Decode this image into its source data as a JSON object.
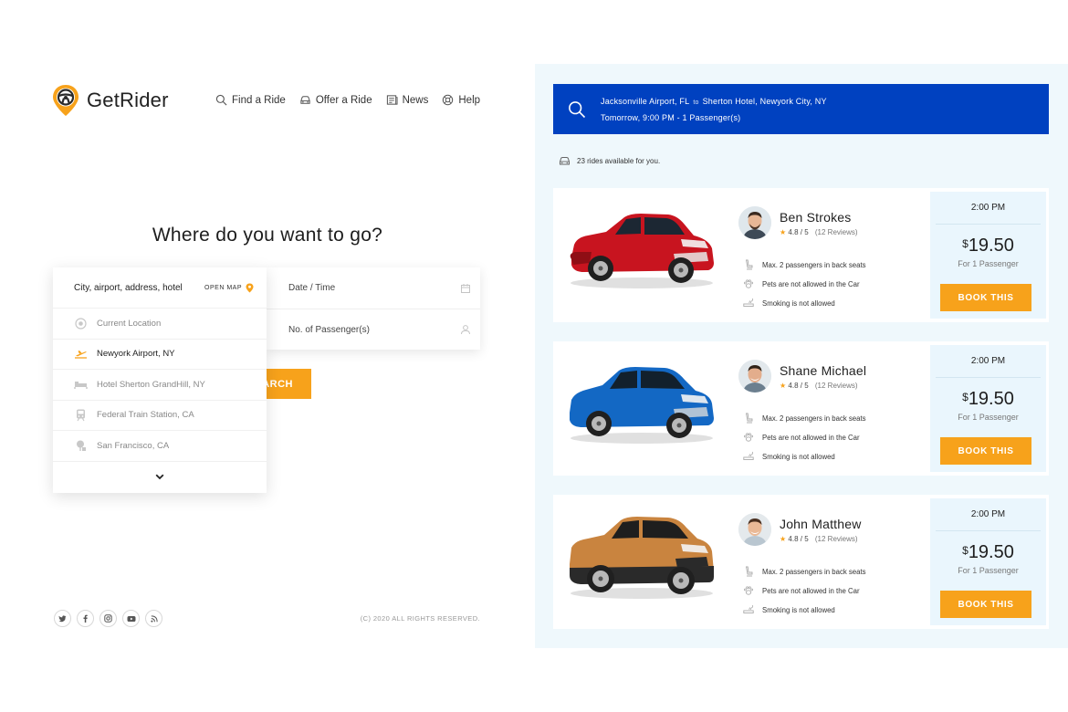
{
  "brand": {
    "name": "GetRider",
    "accent": "#f7a21b",
    "primary": "#0041c0"
  },
  "nav": [
    {
      "label": "Find a Ride",
      "icon": "search-icon"
    },
    {
      "label": "Offer a Ride",
      "icon": "car-icon"
    },
    {
      "label": "News",
      "icon": "news-icon"
    },
    {
      "label": "Help",
      "icon": "help-icon"
    }
  ],
  "hero": {
    "title": "Where do you want to go?"
  },
  "form": {
    "destination_label": "City, airport, address, hotel",
    "open_map_label": "OPEN MAP",
    "date_label": "Date / Time",
    "passengers_label": "No. of Passenger(s)",
    "search_label": "ARCH"
  },
  "dropdown": {
    "items": [
      {
        "label": "Current Location",
        "icon": "location-target-icon",
        "active": false
      },
      {
        "label": "Newyork Airport, NY",
        "icon": "plane-icon",
        "active": true
      },
      {
        "label": "Hotel Sherton GrandHill, NY",
        "icon": "bed-icon",
        "active": false
      },
      {
        "label": "Federal Train Station, CA",
        "icon": "train-icon",
        "active": false
      },
      {
        "label": "San Francisco, CA",
        "icon": "tree-icon",
        "active": false
      }
    ]
  },
  "social": [
    "twitter-icon",
    "facebook-icon",
    "instagram-icon",
    "youtube-icon",
    "rss-icon"
  ],
  "footer": {
    "copyright": "(C) 2020 ALL RIGHTS RESERVED."
  },
  "trip": {
    "from": "Jacksonville  Airport, FL",
    "to_word": "to",
    "to": "Sherton Hotel, Newyork City, NY",
    "when": "Tomorrow, 9:00 PM - 1 Passenger(s)",
    "rides_available": "23 rides available for you."
  },
  "rides": [
    {
      "driver": "Ben Strokes",
      "rating": "4.8 / 5",
      "reviews": "(12 Reviews)",
      "features": [
        "Max. 2 passengers in back seats",
        "Pets are not allowed in the Car",
        "Smoking is not allowed"
      ],
      "time": "2:00 PM",
      "currency": "$",
      "price": "19.50",
      "price_note": "For 1 Passenger",
      "book_label": "BOOK THIS",
      "car_color": "#c8141f"
    },
    {
      "driver": "Shane Michael",
      "rating": "4.8 / 5",
      "reviews": "(12 Reviews)",
      "features": [
        "Max. 2 passengers in back seats",
        "Pets are not allowed in the Car",
        "Smoking is not allowed"
      ],
      "time": "2:00 PM",
      "currency": "$",
      "price": "19.50",
      "price_note": "For 1 Passenger",
      "book_label": "BOOK THIS",
      "car_color": "#1368c4"
    },
    {
      "driver": "John Matthew",
      "rating": "4.8 / 5",
      "reviews": "(12 Reviews)",
      "features": [
        "Max. 2 passengers in back seats",
        "Pets are not allowed in the Car",
        "Smoking is not allowed"
      ],
      "time": "2:00 PM",
      "currency": "$",
      "price": "19.50",
      "price_note": "For 1 Passenger",
      "book_label": "BOOK THIS",
      "car_color": "#c9843f"
    }
  ]
}
